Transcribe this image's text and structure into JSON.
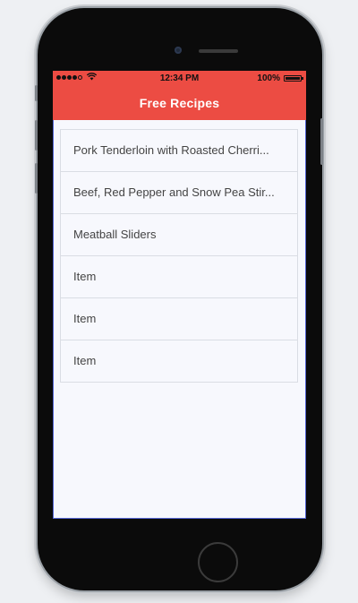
{
  "statusbar": {
    "time": "12:34 PM",
    "battery_text": "100%",
    "signal_dots": 5,
    "signal_filled": 4,
    "battery_level": 1.0
  },
  "navbar": {
    "title": "Free Recipes"
  },
  "recipes": [
    {
      "label": "Pork Tenderloin with Roasted Cherri..."
    },
    {
      "label": "Beef, Red Pepper and Snow Pea Stir..."
    },
    {
      "label": "Meatball Sliders"
    },
    {
      "label": "Item"
    },
    {
      "label": "Item"
    },
    {
      "label": "Item"
    }
  ],
  "colors": {
    "accent": "#ec4c43",
    "background": "#f7f8fd",
    "divider": "#dadde4",
    "page": "#eef0f3"
  },
  "icons": {
    "wifi": "wifi-icon",
    "battery": "battery-icon",
    "signal": "signal-icon"
  }
}
